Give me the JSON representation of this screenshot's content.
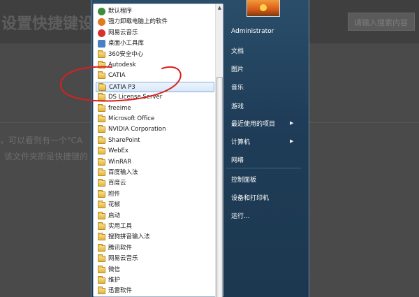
{
  "background_page": {
    "title": "设置快捷键设置",
    "search_placeholder": "请输入搜索内容",
    "line1": "，可以看到有一个\"CA",
    "line2": "该文件夹即是快捷键的"
  },
  "programs": [
    {
      "label": "默认程序",
      "icon": "default-programs-icon",
      "color": "#3c8c3c"
    },
    {
      "label": "强力卸载电脑上的软件",
      "icon": "uninstaller-icon",
      "color": "#e07a1c"
    },
    {
      "label": "网易云音乐",
      "icon": "netease-music-icon",
      "color": "#d9302a"
    },
    {
      "label": "桌面小工具库",
      "icon": "gadgets-icon",
      "color": "#4a7fc8"
    },
    {
      "label": "360安全中心",
      "icon": "folder-icon"
    },
    {
      "label": "Autodesk",
      "icon": "folder-icon"
    },
    {
      "label": "CATIA",
      "icon": "folder-icon"
    },
    {
      "label": "CATIA P3",
      "icon": "folder-icon",
      "selected": true
    },
    {
      "label": "DS License Server",
      "icon": "folder-icon"
    },
    {
      "label": "freeime",
      "icon": "folder-icon"
    },
    {
      "label": "Microsoft Office",
      "icon": "folder-icon"
    },
    {
      "label": "NVIDIA Corporation",
      "icon": "folder-icon"
    },
    {
      "label": "SharePoint",
      "icon": "folder-icon"
    },
    {
      "label": "WebEx",
      "icon": "folder-icon"
    },
    {
      "label": "WinRAR",
      "icon": "folder-icon"
    },
    {
      "label": "百度输入法",
      "icon": "folder-icon"
    },
    {
      "label": "百度云",
      "icon": "folder-icon"
    },
    {
      "label": "附件",
      "icon": "folder-icon"
    },
    {
      "label": "花椒",
      "icon": "folder-icon"
    },
    {
      "label": "启动",
      "icon": "folder-icon"
    },
    {
      "label": "实用工具",
      "icon": "folder-icon"
    },
    {
      "label": "搜狗拼音输入法",
      "icon": "folder-icon"
    },
    {
      "label": "腾讯软件",
      "icon": "folder-icon"
    },
    {
      "label": "网易云音乐",
      "icon": "folder-icon"
    },
    {
      "label": "微信",
      "icon": "folder-icon"
    },
    {
      "label": "维护",
      "icon": "folder-icon"
    },
    {
      "label": "迅雷软件",
      "icon": "folder-icon"
    }
  ],
  "right_pane": {
    "user": "Administrator",
    "documents": "文档",
    "pictures": "图片",
    "music": "音乐",
    "games": "游戏",
    "recent": "最近使用的项目",
    "computer": "计算机",
    "network": "网络",
    "control_panel": "控制面板",
    "devices": "设备和打印机",
    "run": "运行..."
  },
  "colors": {
    "annotation": "#d9201f",
    "menu_blue": "#1f3d58",
    "selected_bg": "#d7e7f8"
  }
}
